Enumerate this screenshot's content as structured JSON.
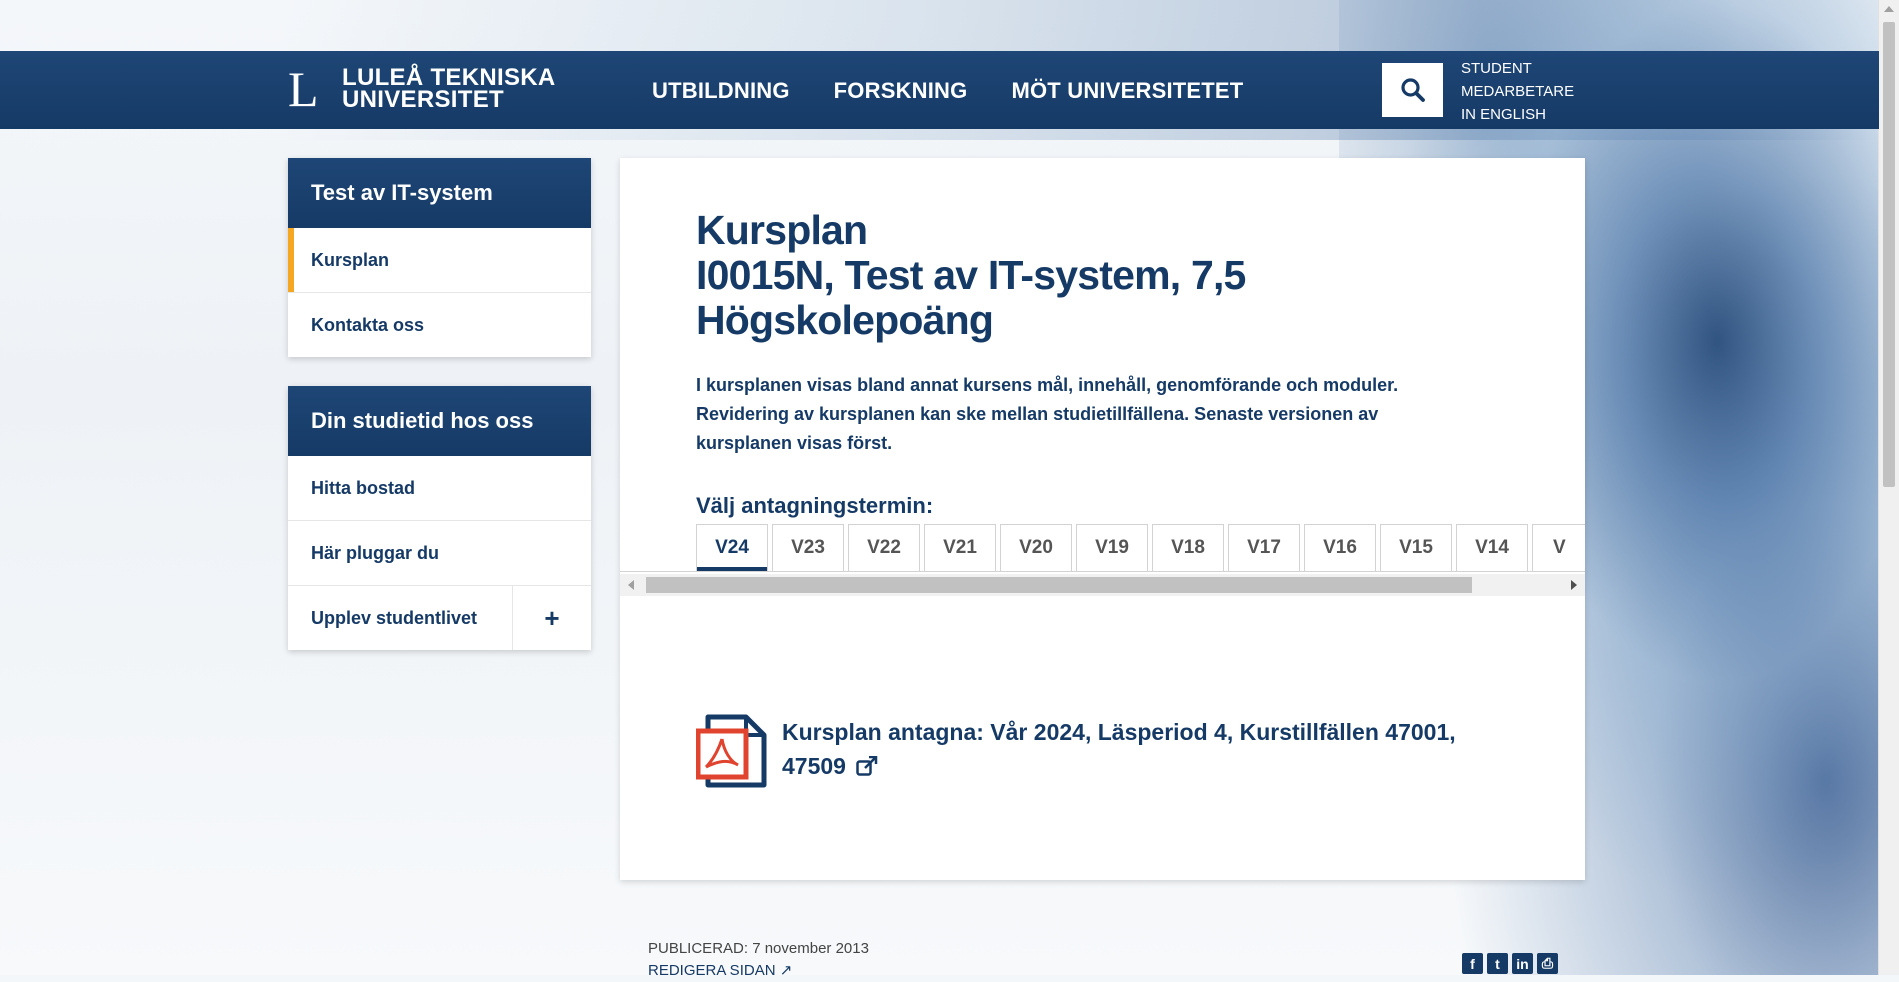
{
  "header": {
    "logo_line1": "LULEÅ TEKNISKA",
    "logo_line2": "UNIVERSITET",
    "logo_mark": "L",
    "nav": [
      "UTBILDNING",
      "FORSKNING",
      "MÖT UNIVERSITETET"
    ],
    "utility": [
      "STUDENT",
      "MEDARBETARE",
      "IN ENGLISH"
    ],
    "search_icon": "search-icon"
  },
  "sidebar": {
    "course_box": {
      "title": "Test av IT-system",
      "items": [
        "Kursplan",
        "Kontakta oss"
      ],
      "active_index": 0
    },
    "study_box": {
      "title": "Din studietid hos oss",
      "items": [
        "Hitta bostad",
        "Här pluggar du",
        "Upplev studentlivet"
      ],
      "expand_label": "+"
    }
  },
  "main": {
    "title_line1": "Kursplan",
    "title_line2": "I0015N, Test av IT-system, 7,5",
    "title_line3": "Högskolepoäng",
    "intro": "I kursplanen visas bland annat kursens mål, innehåll, genomförande och moduler. Revidering av kursplanen kan ske mellan studietillfällena. Senaste versionen av kursplanen visas först.",
    "term_label": "Välj antagningstermin:",
    "tabs": [
      "V24",
      "V23",
      "V22",
      "V21",
      "V20",
      "V19",
      "V18",
      "V17",
      "V16",
      "V15",
      "V14",
      "V"
    ],
    "active_tab": 0,
    "document": {
      "label_line1": "Kursplan antagna: Vår 2024, Läsperiod 4, Kurstillfällen 47001,",
      "label_line2": "47509",
      "icon": "pdf-icon",
      "external_icon": "external-link-icon"
    }
  },
  "footer": {
    "published": "PUBLICERAD: 7 november 2013",
    "edit": "REDIGERA SIDAN",
    "social": [
      "facebook-icon",
      "twitter-icon",
      "linkedin-icon",
      "print-icon"
    ]
  },
  "colors": {
    "brand_navy": "#163a66",
    "accent_orange": "#f5a623",
    "pdf_red": "#e0442e"
  }
}
